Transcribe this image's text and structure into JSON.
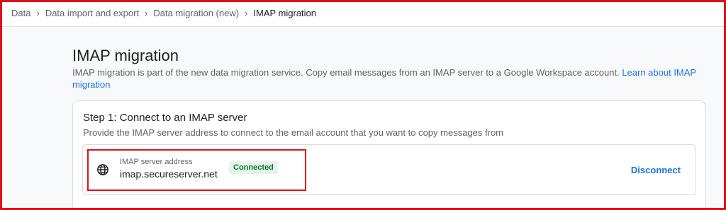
{
  "breadcrumb": {
    "items": [
      "Data",
      "Data import and export",
      "Data migration (new)"
    ],
    "current": "IMAP migration"
  },
  "page": {
    "title": "IMAP migration",
    "description": "IMAP migration is part of the new data migration service. Copy email messages from an IMAP server to a Google Workspace account.",
    "learn_more_link": "Learn about IMAP migration"
  },
  "step1": {
    "title": "Step 1: Connect to an IMAP server",
    "description": "Provide the IMAP server address to connect to the email account that you want to copy messages from",
    "server": {
      "label": "IMAP server address",
      "value": "imap.secureserver.net",
      "status": "Connected",
      "icon": "globe-icon",
      "action_label": "Disconnect"
    }
  },
  "colors": {
    "accent": "#1a73e8",
    "connected_bg": "#e6f4ea",
    "connected_text": "#137333",
    "highlight": "#e0101a"
  }
}
